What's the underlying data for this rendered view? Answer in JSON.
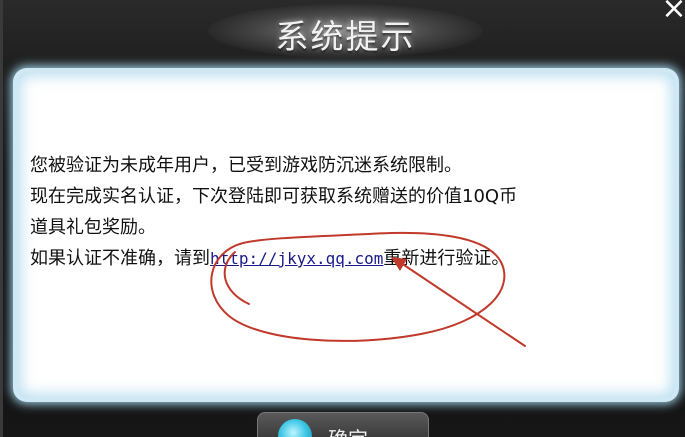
{
  "dialog": {
    "title": "系统提示",
    "close_symbol": "×",
    "message_lines": [
      "您被验证为未成年用户，已受到游戏防沉迷系统限制。",
      "现在完成实名认证，下次登陆即可获取系统赠送的价值10Q币",
      "道具礼包奖励。"
    ],
    "last_line": {
      "before": "如果认证不准确，请到",
      "link": "http://jkyx.qq.com",
      "after": "重新进行验证。"
    },
    "confirm_button": {
      "label": "确定",
      "icon": "circle-icon"
    }
  },
  "colors": {
    "frame_background": "#111111",
    "content_background": "#ffffff",
    "content_glow": "#9fd3ea",
    "text": "#111111",
    "link": "#1a1a8a",
    "annotation": "#c0392b"
  }
}
